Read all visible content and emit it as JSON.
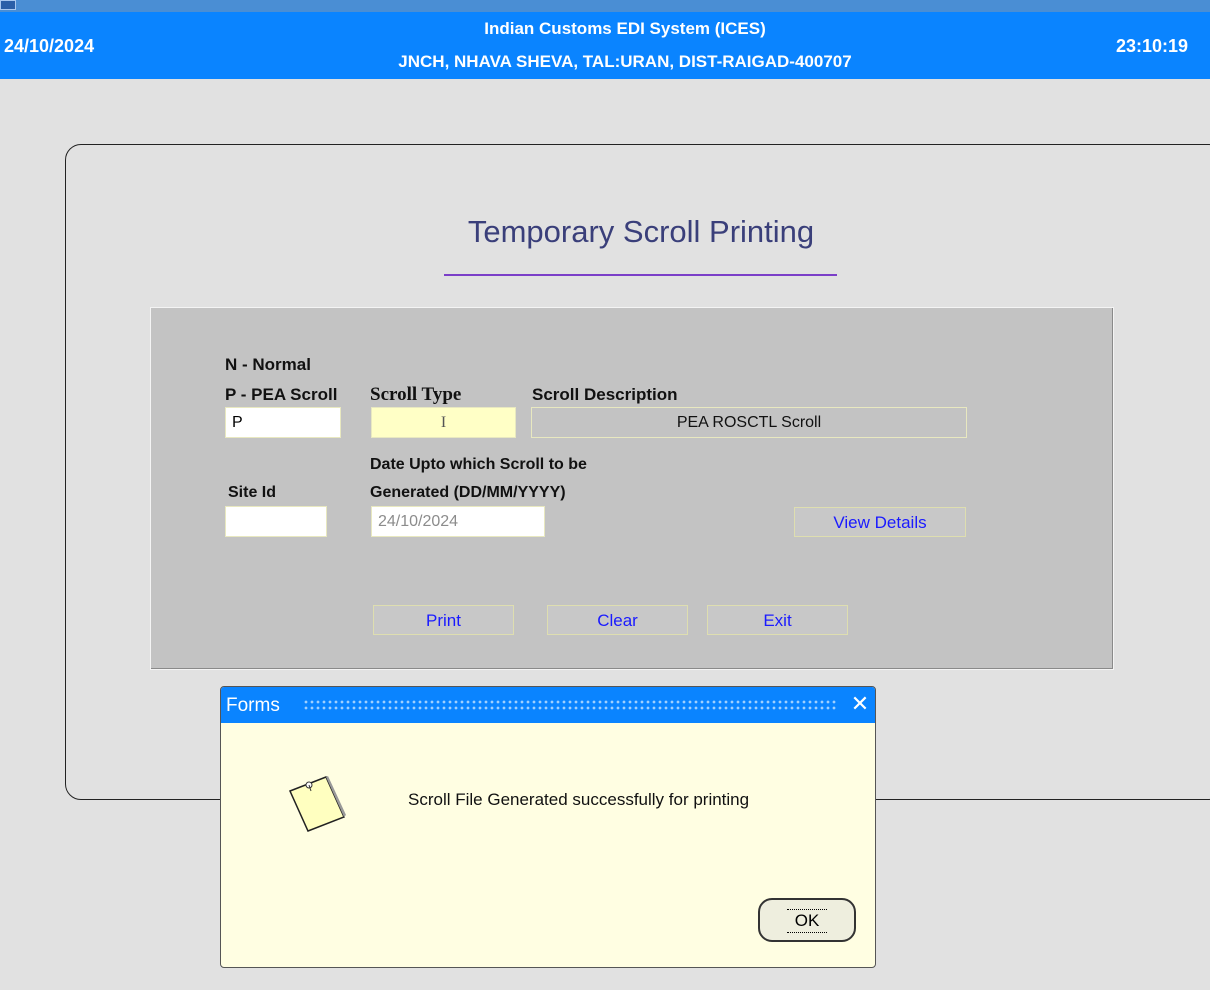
{
  "header": {
    "date": "24/10/2024",
    "title_line1": "Indian Customs EDI System (ICES)",
    "title_line2": "JNCH, NHAVA SHEVA, TAL:URAN, DIST-RAIGAD-400707",
    "time": "23:10:19",
    "color": "#0a84ff"
  },
  "page": {
    "title": "Temporary Scroll Printing"
  },
  "form": {
    "legend_normal": "N - Normal",
    "legend_pea": "P - PEA Scroll",
    "scroll_type_label": "Scroll Type",
    "scroll_description_label": "Scroll Description",
    "type_code_value": "P",
    "scroll_type_value": "I",
    "scroll_description_value": "PEA ROSCTL Scroll",
    "site_id_label": "Site Id",
    "site_id_value": "",
    "date_label_line1": "Date Upto which Scroll to be",
    "date_label_line2": "Generated (DD/MM/YYYY)",
    "date_value": "24/10/2024",
    "view_details_button": "View Details",
    "print_button": "Print",
    "clear_button": "Clear",
    "exit_button": "Exit"
  },
  "dialog": {
    "title": "Forms",
    "close_glyph": "✕",
    "message": "Scroll File Generated successfully for printing",
    "ok_button": "OK",
    "icon": "note-icon"
  }
}
